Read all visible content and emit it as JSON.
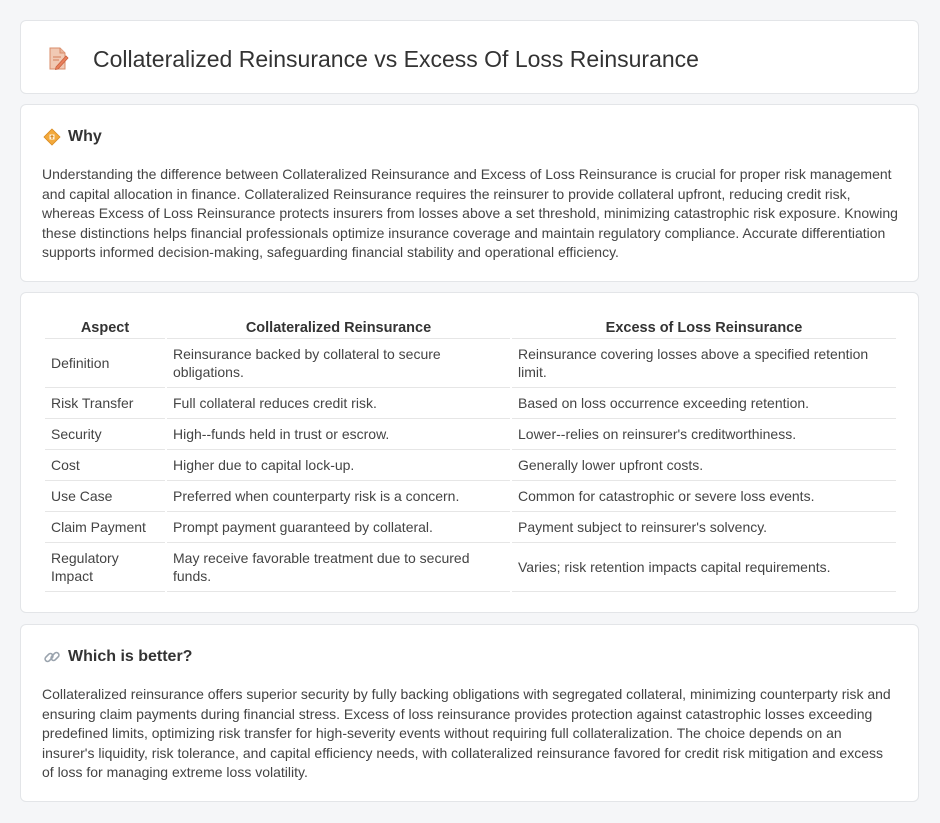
{
  "header": {
    "title": "Collateralized Reinsurance vs Excess Of Loss Reinsurance",
    "icon": "document-pen-icon"
  },
  "why": {
    "title": "Why",
    "icon": "diamond-warning-icon",
    "text": "Understanding the difference between Collateralized Reinsurance and Excess of Loss Reinsurance is crucial for proper risk management and capital allocation in finance. Collateralized Reinsurance requires the reinsurer to provide collateral upfront, reducing credit risk, whereas Excess of Loss Reinsurance protects insurers from losses above a set threshold, minimizing catastrophic risk exposure. Knowing these distinctions helps financial professionals optimize insurance coverage and maintain regulatory compliance. Accurate differentiation supports informed decision-making, safeguarding financial stability and operational efficiency."
  },
  "table": {
    "headers": [
      "Aspect",
      "Collateralized Reinsurance",
      "Excess of Loss Reinsurance"
    ],
    "rows": [
      [
        "Definition",
        "Reinsurance backed by collateral to secure obligations.",
        "Reinsurance covering losses above a specified retention limit."
      ],
      [
        "Risk Transfer",
        "Full collateral reduces credit risk.",
        "Based on loss occurrence exceeding retention."
      ],
      [
        "Security",
        "High--funds held in trust or escrow.",
        "Lower--relies on reinsurer's creditworthiness."
      ],
      [
        "Cost",
        "Higher due to capital lock-up.",
        "Generally lower upfront costs."
      ],
      [
        "Use Case",
        "Preferred when counterparty risk is a concern.",
        "Common for catastrophic or severe loss events."
      ],
      [
        "Claim Payment",
        "Prompt payment guaranteed by collateral.",
        "Payment subject to reinsurer's solvency."
      ],
      [
        "Regulatory Impact",
        "May receive favorable treatment due to secured funds.",
        "Varies; risk retention impacts capital requirements."
      ]
    ]
  },
  "better": {
    "title": "Which is better?",
    "icon": "link-icon",
    "text": "Collateralized reinsurance offers superior security by fully backing obligations with segregated collateral, minimizing counterparty risk and ensuring claim payments during financial stress. Excess of loss reinsurance provides protection against catastrophic losses exceeding predefined limits, optimizing risk transfer for high-severity events without requiring full collateralization. The choice depends on an insurer's liquidity, risk tolerance, and capital efficiency needs, with collateralized reinsurance favored for credit risk mitigation and excess of loss for managing extreme loss volatility."
  }
}
